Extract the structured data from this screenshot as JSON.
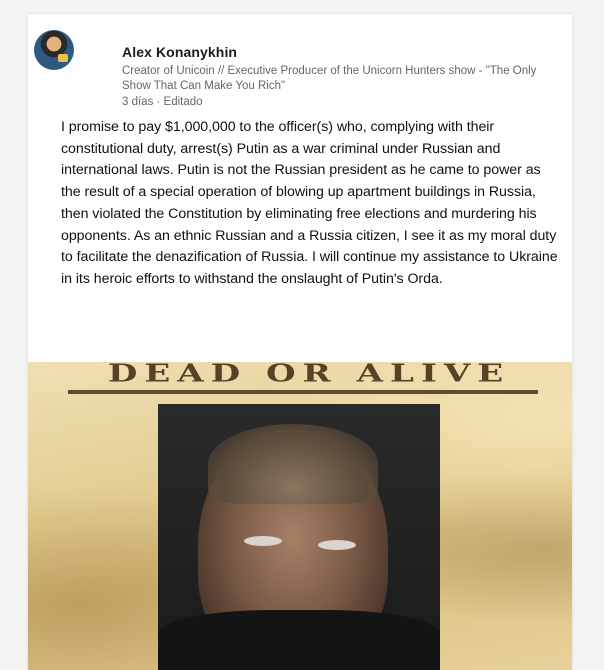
{
  "post": {
    "author_name": "Alex Konanykhin",
    "author_headline": "Creator of Unicoin // Executive Producer of the Unicorn Hunters show - \"The Only Show That Can Make You Rich\"",
    "meta": "3 días · Editado",
    "text": "I promise to pay $1,000,000 to the officer(s) who, complying with their constitutional duty, arrest(s) Putin as a war criminal under Russian and international laws. Putin is not the Russian president as he came to power as the result of a special operation of blowing up apartment buildings in Russia, then violated the Constitution by eliminating free elections and murdering his opponents. As an ethnic Russian and a Russia citizen, I see it as my moral duty to facilitate the denazification of Russia. I will continue my assistance to Ukraine in its heroic efforts to withstand the onslaught of Putin's Orda."
  },
  "image": {
    "poster_heading": "DEAD OR ALIVE"
  },
  "colors": {
    "text": "#111111",
    "secondary_text": "#666666",
    "poster_paper": "#e3cd92"
  }
}
